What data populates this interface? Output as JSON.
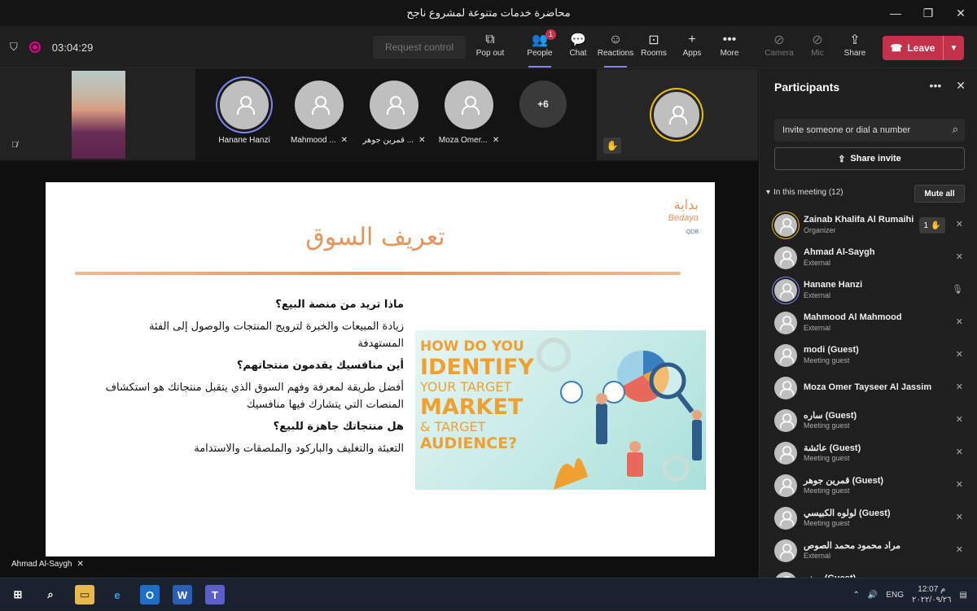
{
  "window": {
    "title": "محاضرة خدمات متنوعة لمشروع ناجح",
    "controls": [
      "—",
      "❐",
      "✕"
    ]
  },
  "toolbar": {
    "timer": "03:04:29",
    "request_control": "Request control",
    "tools": [
      {
        "label": "Pop out",
        "icon": "⧉"
      },
      {
        "label": "People",
        "icon": "👥",
        "badge": "1"
      },
      {
        "label": "Chat",
        "icon": "💬"
      },
      {
        "label": "Reactions",
        "icon": "☺"
      },
      {
        "label": "Rooms",
        "icon": "⊡"
      },
      {
        "label": "Apps",
        "icon": "+"
      },
      {
        "label": "More",
        "icon": "•••"
      },
      {
        "label": "Camera",
        "icon": "⊘"
      },
      {
        "label": "Mic",
        "icon": "⊘"
      },
      {
        "label": "Share",
        "icon": "⇪"
      }
    ],
    "leave": "Leave"
  },
  "gallery": {
    "tiles": [
      {
        "name": "Hanane Hanzi"
      },
      {
        "name": "Mahmood ..."
      },
      {
        "name": "قمرين جوهر ..."
      },
      {
        "name": "Moza Omer..."
      }
    ],
    "overflow": "+6"
  },
  "slide": {
    "title": "تعريف السوق",
    "logo_ar": "بداية",
    "logo_en": "Bedaya",
    "logo_small": "QDB",
    "blocks": [
      {
        "q": "ماذا تريد من منصة البيع؟",
        "a": "زيادة المبيعات والخبرة لترويج المنتجات والوصول إلى الفئة المستهدفة"
      },
      {
        "q": "أين منافسيك يقدمون منتجاتهم؟",
        "a": "أفضل طريقة لمعرفة وفهم السوق الذي يتقبل منتجاتك هو استكشاف المنصات التي يتشارك فيها منافسيك"
      },
      {
        "q": "هل منتجاتك جاهزة للبيع؟",
        "a": "التعبئة والتغليف والباركود والملصقات والاستدامة"
      }
    ],
    "poster": {
      "l1": "HOW DO YOU",
      "l2": "IDENTIFY",
      "l3": "YOUR TARGET",
      "l4": "MARKET",
      "l5": "& TARGET",
      "l6": "AUDIENCE?"
    }
  },
  "presenter": "Ahmad Al-Saygh",
  "panel": {
    "title": "Participants",
    "invite_placeholder": "Invite someone or dial a number",
    "share_invite": "Share invite",
    "in_meeting": "In this meeting (12)",
    "mute_all": "Mute all",
    "participants": [
      {
        "name": "Zainab Khalifa Al Rumaihi",
        "role": "Organizer",
        "hand": "1"
      },
      {
        "name": "Ahmad Al-Saygh",
        "role": "External"
      },
      {
        "name": "Hanane Hanzi",
        "role": "External"
      },
      {
        "name": "Mahmood Al Mahmood",
        "role": "External"
      },
      {
        "name": "modi (Guest)",
        "role": "Meeting guest"
      },
      {
        "name": "Moza Omer Tayseer Al Jassim",
        "role": ""
      },
      {
        "name": "ساره (Guest)",
        "role": "Meeting guest"
      },
      {
        "name": "عائشة (Guest)",
        "role": "Meeting guest"
      },
      {
        "name": "قمرين جوهر (Guest)",
        "role": "Meeting guest"
      },
      {
        "name": "لولوه الكبيسي (Guest)",
        "role": "Meeting guest"
      },
      {
        "name": "مراد محمود محمد الصوص",
        "role": "External"
      },
      {
        "name": "موزه (Guest)",
        "role": ""
      }
    ]
  },
  "taskbar": {
    "lang": "ENG",
    "time": "12:07 م",
    "date": "٢٠٢٢/٠٩/٢٦"
  }
}
